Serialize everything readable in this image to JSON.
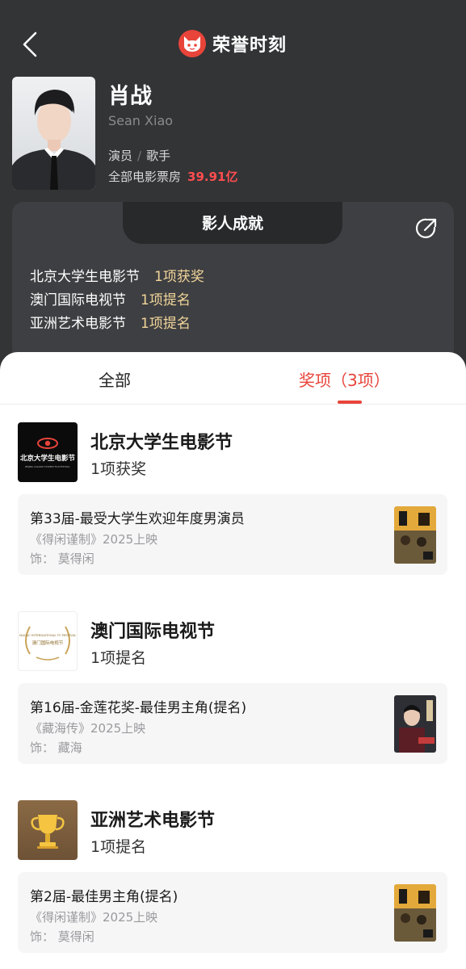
{
  "header": {
    "brand_title": "荣誉时刻",
    "back_icon": "chevron-left-icon",
    "logo_icon": "cat-logo-icon",
    "brand_color": "#e8443a"
  },
  "profile": {
    "name": "肖战",
    "english_name": "Sean Xiao",
    "role_1": "演员",
    "role_sep": "/",
    "role_2": "歌手",
    "box_office_label": "全部电影票房",
    "box_office_value": "39.91亿"
  },
  "achievements": {
    "title": "影人成就",
    "share_icon": "share-icon",
    "rows": [
      {
        "festival": "北京大学生电影节",
        "count": "1项获奖"
      },
      {
        "festival": "澳门国际电视节",
        "count": "1项提名"
      },
      {
        "festival": "亚洲艺术电影节",
        "count": "1项提名"
      }
    ]
  },
  "tabs": {
    "all": "全部",
    "awards": "奖项（3项）"
  },
  "festivals": [
    {
      "name": "北京大学生电影节",
      "count": "1项获奖",
      "logo_text": "北京大学生电影节",
      "logo_subtext": "BEIJING COLLEGE STUDENT FILM FESTIVAL",
      "award": {
        "title": "第33届-最受大学生欢迎年度男演员",
        "movie": "《得闲谨制》2025上映",
        "role": "饰：  莫得闲"
      }
    },
    {
      "name": "澳门国际电视节",
      "count": "1项提名",
      "logo_text": "澳门国际电视节",
      "logo_subtext": "MACAU INTERNATIONAL TV FESTIVAL",
      "award": {
        "title": "第16届-金莲花奖-最佳男主角(提名)",
        "movie": "《藏海传》2025上映",
        "role": "饰：  藏海"
      }
    },
    {
      "name": "亚洲艺术电影节",
      "count": "1项提名",
      "logo_icon": "trophy-icon",
      "award": {
        "title": "第2届-最佳男主角(提名)",
        "movie": "《得闲谨制》2025上映",
        "role": "饰：  莫得闲"
      }
    }
  ]
}
